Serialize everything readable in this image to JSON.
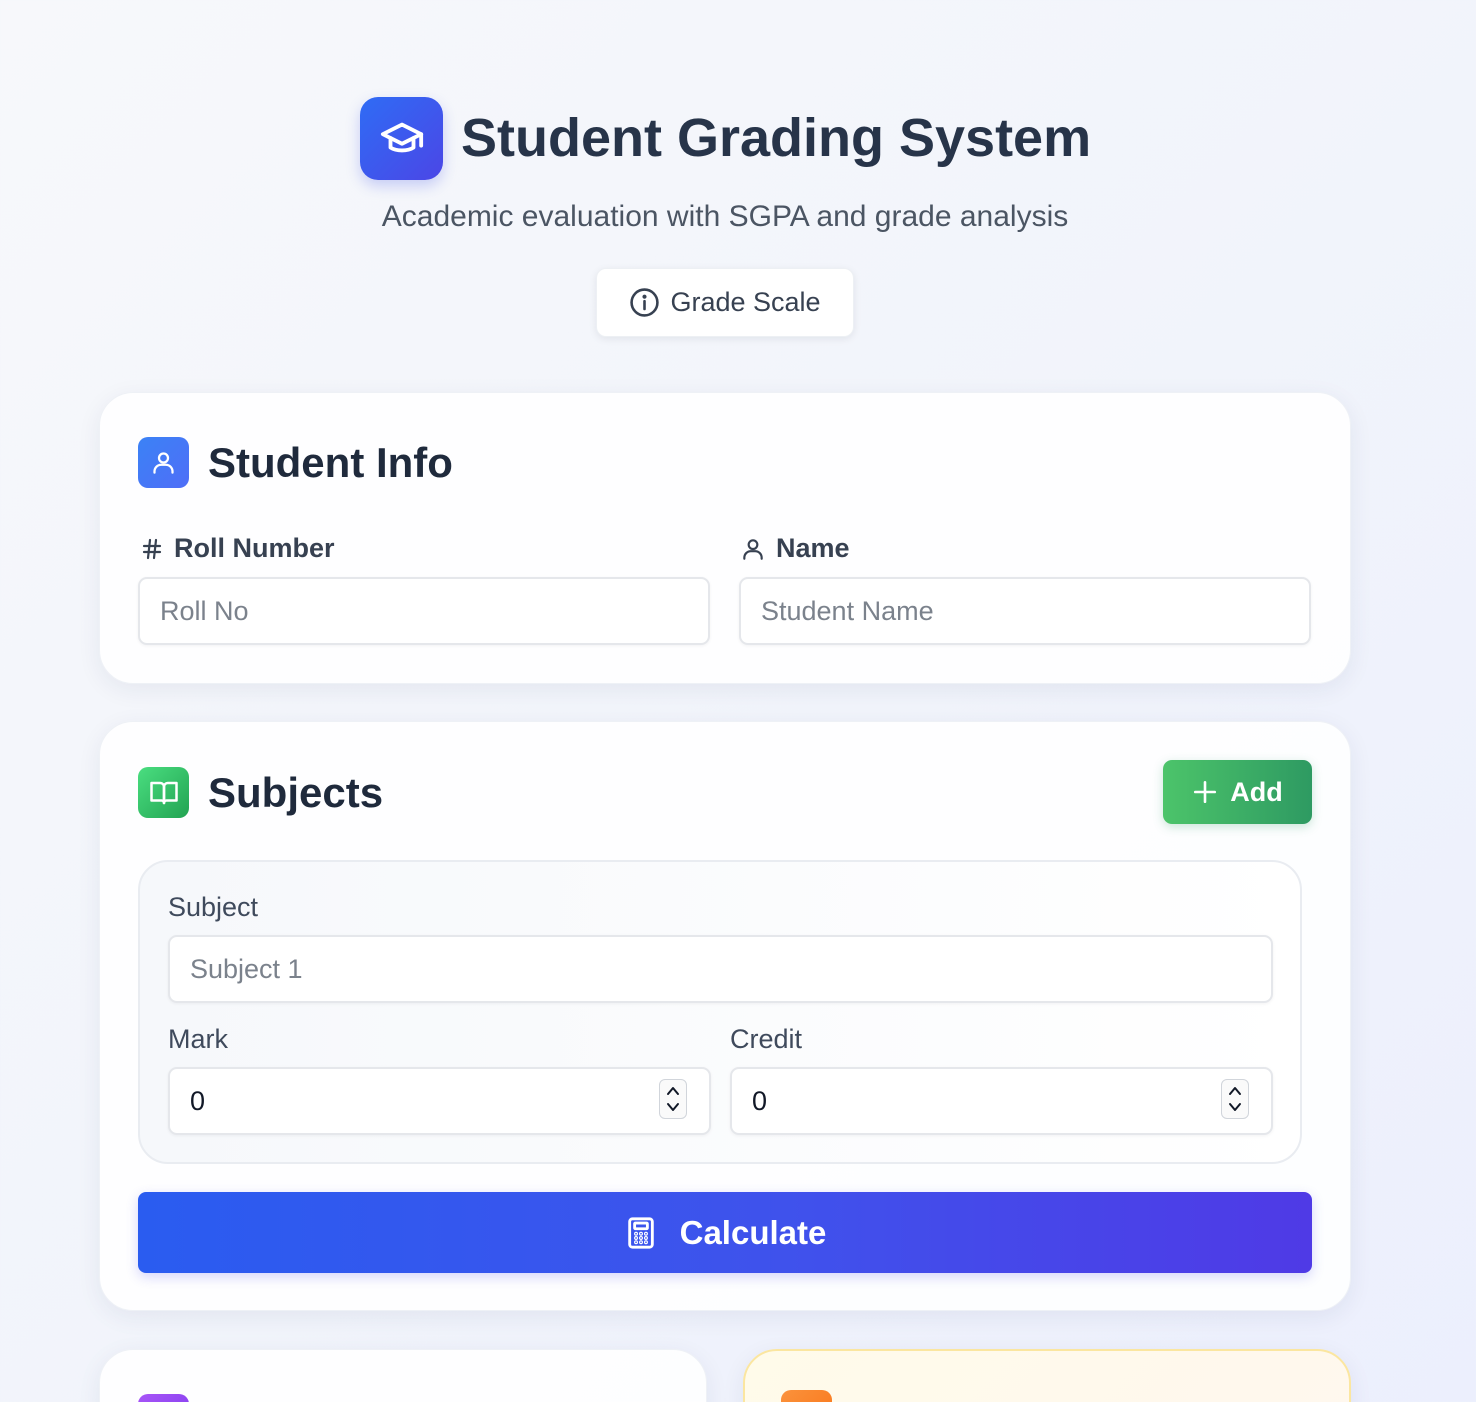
{
  "header": {
    "title": "Student Grading System",
    "subtitle": "Academic evaluation with SGPA and grade analysis",
    "grade_scale_label": "Grade Scale",
    "logo_icon": "graduation-cap-icon"
  },
  "student_info": {
    "title": "Student Info",
    "icon": "user-icon",
    "roll_number": {
      "label": "Roll Number",
      "icon": "hash-icon",
      "placeholder": "Roll No",
      "value": ""
    },
    "name": {
      "label": "Name",
      "icon": "user-icon",
      "placeholder": "Student Name",
      "value": ""
    }
  },
  "subjects": {
    "title": "Subjects",
    "icon": "book-open-icon",
    "add_label": "Add",
    "items": [
      {
        "subject_label": "Subject",
        "subject_placeholder": "Subject 1",
        "mark_label": "Mark",
        "mark_value": "0",
        "credit_label": "Credit",
        "credit_value": "0"
      }
    ],
    "calculate_label": "Calculate"
  },
  "colors": {
    "primary": "#3b5bf0",
    "accent_purple": "#4f3ae6",
    "success": "#3fb566",
    "heading": "#1f2a3c"
  }
}
